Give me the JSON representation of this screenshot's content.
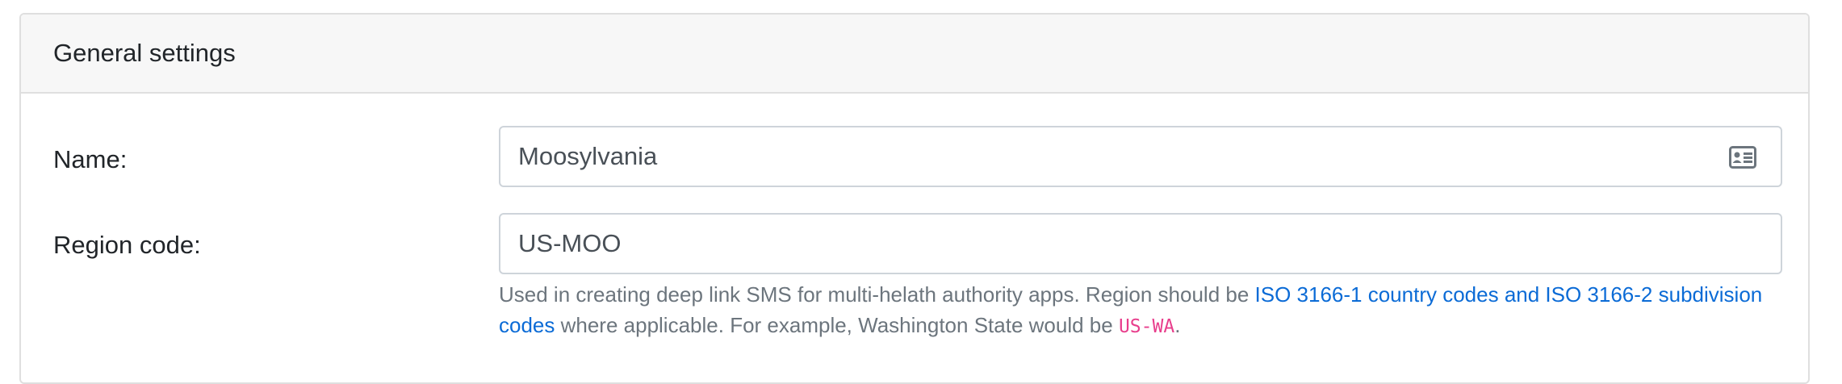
{
  "card": {
    "title": "General settings"
  },
  "fields": {
    "name": {
      "label": "Name:",
      "value": "Moosylvania",
      "icon": "contact-card-icon"
    },
    "region_code": {
      "label": "Region code:",
      "value": "US-MOO",
      "help_prefix": "Used in creating deep link SMS for multi-helath authority apps. Region should be ",
      "help_link": "ISO 3166-1 country codes and ISO 3166-2 subdivision codes",
      "help_middle": " where applicable. For example, Washington State would be ",
      "help_code": "US-WA",
      "help_suffix": "."
    }
  },
  "colors": {
    "link": "#0b6bd6",
    "code": "#e83e8c",
    "muted": "#6c757d",
    "header_bg": "#f7f7f7"
  }
}
